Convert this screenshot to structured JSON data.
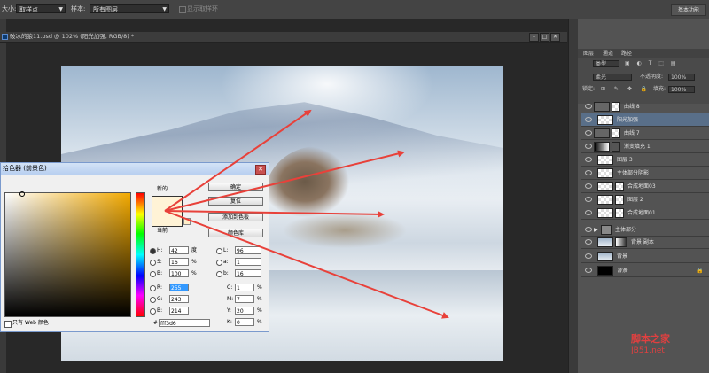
{
  "options_bar": {
    "size_label": "大小:",
    "size_value": "取样点",
    "sample_label": "样本:",
    "sample_value": "所有图层",
    "show_ring_label": "显示取样环",
    "basic_button": "基本功能"
  },
  "document": {
    "tab_title": "破冰的狼11.psd @ 102% (阳光加强, RGB/8) *"
  },
  "layers_panel": {
    "tabs": [
      "图层",
      "通道",
      "路径"
    ],
    "kind_filter": "类型",
    "blend_mode": "柔光",
    "opacity_label": "不透明度:",
    "opacity_value": "100%",
    "lock_label": "锁定:",
    "fill_label": "填充:",
    "fill_value": "100%",
    "layers": [
      {
        "name": "曲线 8"
      },
      {
        "name": "阳光加强"
      },
      {
        "name": "曲线 7"
      },
      {
        "name": "渐变填充 1"
      },
      {
        "name": "图层 3"
      },
      {
        "name": "主体部分阴影"
      },
      {
        "name": "合成地面03"
      },
      {
        "name": "图层 2"
      },
      {
        "name": "合成地面01"
      },
      {
        "name": "主体部分"
      },
      {
        "name": "背景 副本"
      },
      {
        "name": "背景"
      },
      {
        "name": "背景"
      }
    ]
  },
  "color_picker": {
    "title": "拾色器 (前景色)",
    "close_symbol": "✕",
    "new_label": "新的",
    "current_label": "当前",
    "ok_button": "确定",
    "reset_button": "复位",
    "add_swatch_button": "添加到色板",
    "color_libs_button": "颜色库",
    "h_label": "H:",
    "h_value": "42",
    "h_unit": "度",
    "s_label": "S:",
    "s_value": "16",
    "s_unit": "%",
    "b_label": "B:",
    "b_value": "100",
    "b_unit": "%",
    "r_label": "R:",
    "r_value": "255",
    "g_label": "G:",
    "g_value": "243",
    "bl_label": "B:",
    "bl_value": "214",
    "l_label": "L:",
    "l_value": "96",
    "a_label": "a:",
    "a_value": "1",
    "lb_label": "b:",
    "lb_value": "16",
    "c_label": "C:",
    "c_value": "1",
    "c_unit": "%",
    "m_label": "M:",
    "m_value": "7",
    "m_unit": "%",
    "y_label": "Y:",
    "y_value": "20",
    "y_unit": "%",
    "k_label": "K:",
    "k_value": "0",
    "k_unit": "%",
    "hex_label": "#",
    "hex_value": "fff3d6",
    "web_only_label": "只有 Web 颜色",
    "selected_color": "#fff3d6"
  },
  "watermark": {
    "line1": "脚本之家",
    "line2": "JB51.net"
  },
  "colors": {
    "arrow": "#e8413a",
    "selected_layer": "#596f89"
  }
}
